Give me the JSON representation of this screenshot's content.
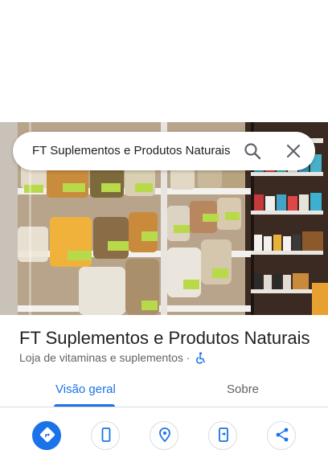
{
  "search": {
    "query": "FT Suplementos e Produtos Naturais"
  },
  "place": {
    "name": "FT Suplementos e Produtos Naturais",
    "category": "Loja de vitaminas e suplementos",
    "separator": "·"
  },
  "tabs": [
    {
      "label": "Visão geral",
      "selected": true
    },
    {
      "label": "Sobre",
      "selected": false
    }
  ],
  "actions": [
    {
      "icon": "directions-icon"
    },
    {
      "icon": "phone-icon"
    },
    {
      "icon": "save-location-icon"
    },
    {
      "icon": "send-to-phone-icon"
    },
    {
      "icon": "share-icon"
    }
  ],
  "colors": {
    "accent": "#1a73e8",
    "text": "#202124",
    "secondary_text": "#5f6368"
  }
}
